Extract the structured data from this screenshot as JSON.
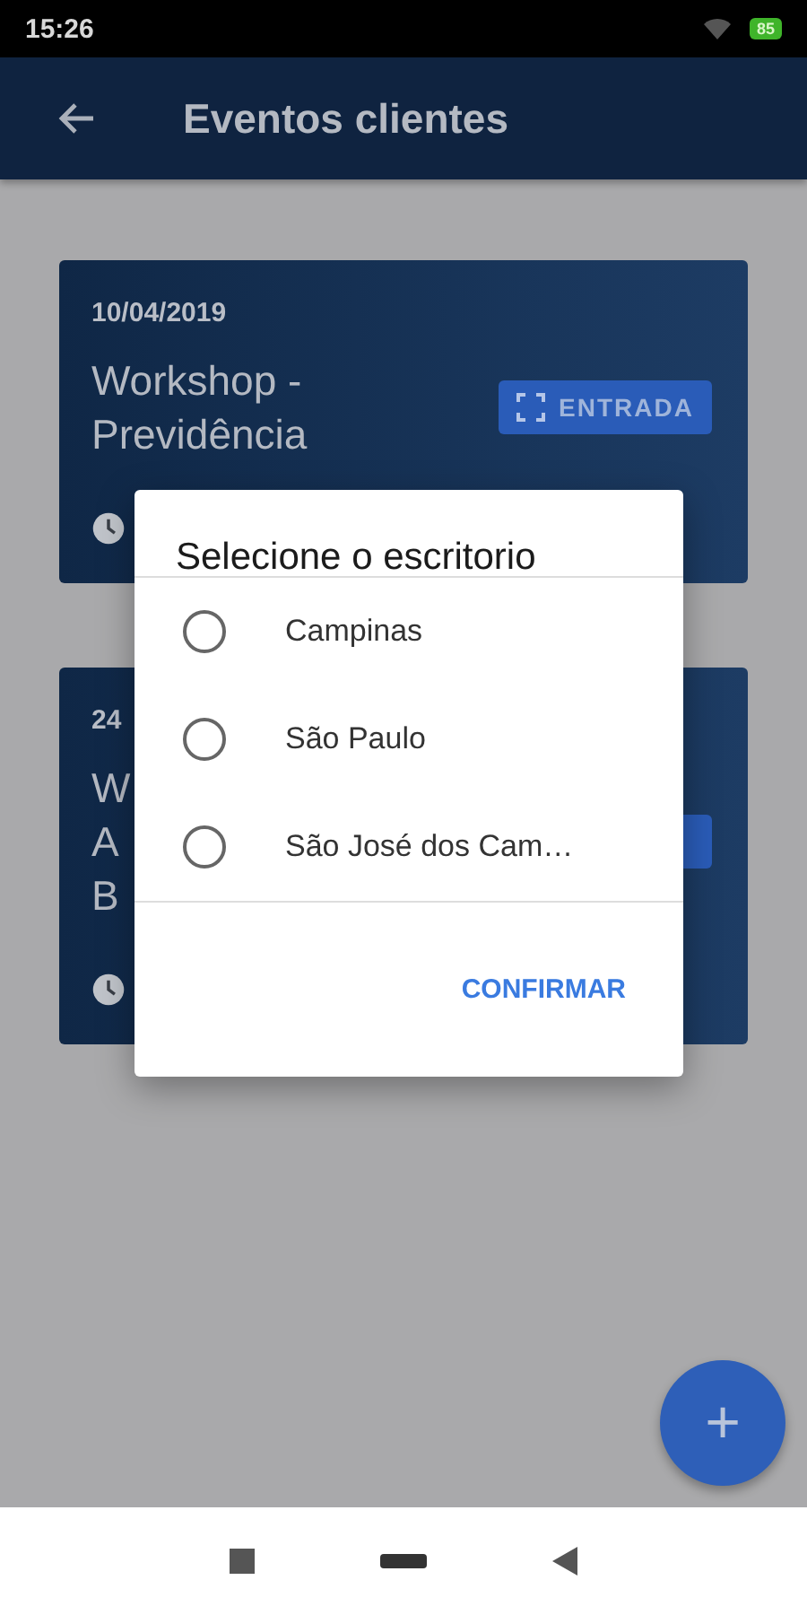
{
  "status_bar": {
    "time": "15:26",
    "battery": "85"
  },
  "app_bar": {
    "title": "Eventos clientes"
  },
  "events": [
    {
      "date": "10/04/2019",
      "title": "Workshop -\nPrevidência",
      "button": "ENTRADA"
    },
    {
      "date": "24",
      "title": "W\nA\nB"
    }
  ],
  "dialog": {
    "title": "Selecione o escritorio",
    "options": [
      {
        "label": "Campinas",
        "selected": false
      },
      {
        "label": "São Paulo",
        "selected": false
      },
      {
        "label": "São José dos Cam…",
        "selected": false
      }
    ],
    "action": "CONFIRMAR"
  },
  "fab": {
    "label": "+"
  }
}
